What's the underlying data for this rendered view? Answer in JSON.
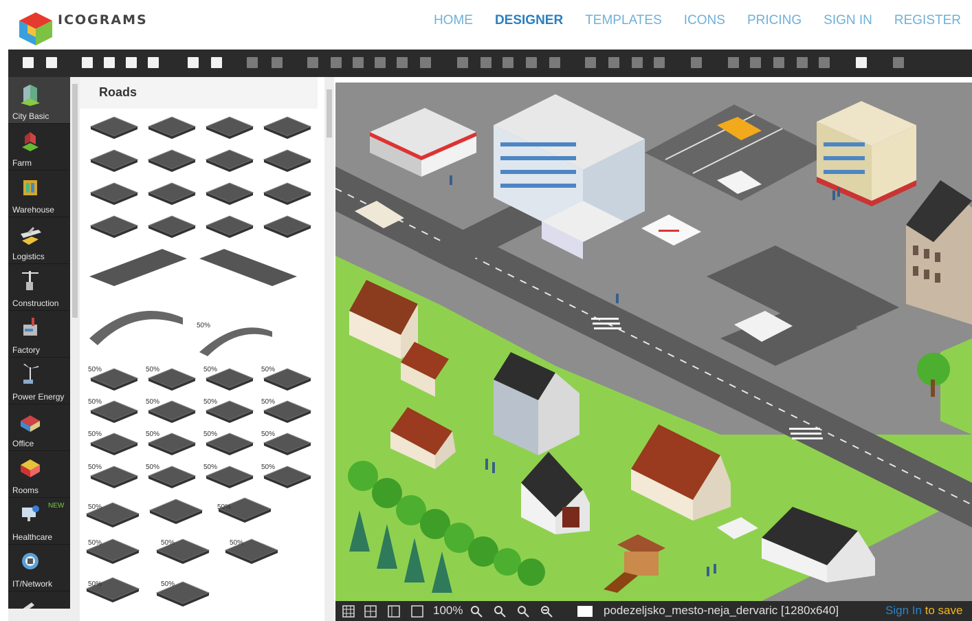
{
  "brand": {
    "name": "ICOGRAMS"
  },
  "nav": [
    {
      "label": "HOME",
      "active": false
    },
    {
      "label": "DESIGNER",
      "active": true
    },
    {
      "label": "TEMPLATES",
      "active": false
    },
    {
      "label": "ICONS",
      "active": false
    },
    {
      "label": "PRICING",
      "active": false
    },
    {
      "label": "SIGN IN",
      "active": false
    },
    {
      "label": "REGISTER",
      "active": false
    }
  ],
  "toolbar": {
    "icons": [
      "new-document-icon",
      "open-folder-icon",
      "import-icon",
      "export-svg-icon",
      "export-png-icon",
      "export-jpg-icon",
      "select-icon",
      "move-icon",
      "undo-icon",
      "delete-icon",
      "align-left-icon",
      "align-right-icon",
      "align-top-icon",
      "align-bottom-icon",
      "move-up-icon",
      "move-down-icon",
      "group-icon",
      "ungroup-icon",
      "distribute-icon",
      "copy-icon",
      "paste-icon",
      "bring-front-icon",
      "send-back-icon",
      "forward-icon",
      "backward-icon",
      "flip-icon",
      "rotate-left-icon",
      "rotate-flat-icon",
      "rotate-center-icon",
      "rotate-tilt-icon",
      "rotate-right-icon",
      "lock-icon",
      "properties-icon"
    ]
  },
  "categories": [
    {
      "label": "City Basic",
      "icon": "city-basic-icon",
      "active": true
    },
    {
      "label": "Farm",
      "icon": "farm-icon"
    },
    {
      "label": "Warehouse",
      "icon": "warehouse-icon"
    },
    {
      "label": "Logistics",
      "icon": "logistics-icon"
    },
    {
      "label": "Construction",
      "icon": "construction-icon"
    },
    {
      "label": "Factory",
      "icon": "factory-icon"
    },
    {
      "label": "Power Energy",
      "icon": "power-energy-icon"
    },
    {
      "label": "Office",
      "icon": "office-icon"
    },
    {
      "label": "Rooms",
      "icon": "rooms-icon"
    },
    {
      "label": "Healthcare",
      "icon": "healthcare-icon",
      "badge": "NEW"
    },
    {
      "label": "IT/Network",
      "icon": "it-network-icon"
    },
    {
      "label": "",
      "icon": "tools-icon"
    }
  ],
  "panel": {
    "title": "Roads",
    "percent_label": "50%"
  },
  "status": {
    "zoom": "100%",
    "filename": "podezeljsko_mesto-neja_dervaric [1280x640]",
    "signin_link": "Sign In",
    "signin_suffix": " to save"
  },
  "colors": {
    "nav": "#6fb0d8",
    "nav_active": "#2a7fbf",
    "toolbar_bg": "#2b2b2b",
    "road": "#5a5a5a",
    "grass": "#8fd14f"
  }
}
